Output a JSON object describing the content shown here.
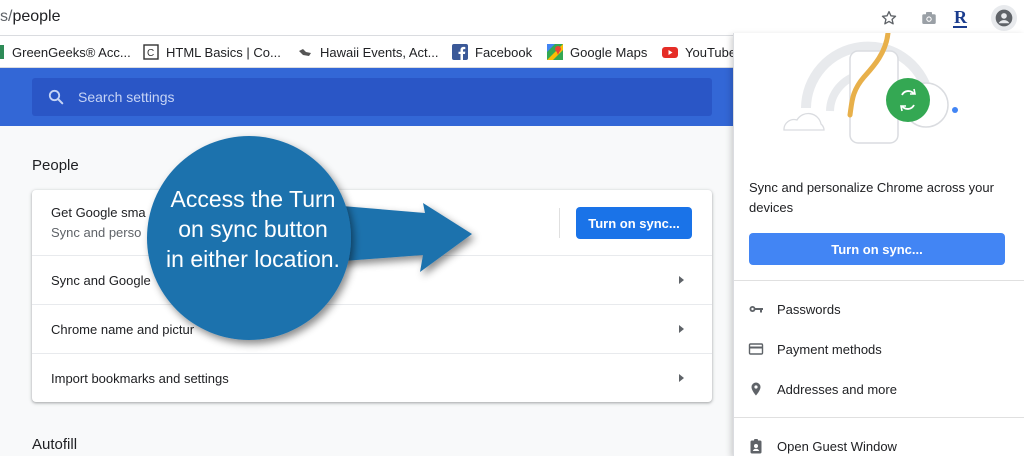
{
  "address_bar": {
    "url_prefix": "s/",
    "url_path": "people"
  },
  "toolbar_icons": [
    "star-icon",
    "camera-icon",
    "extension-r-icon",
    "profile-icon"
  ],
  "bookmarks": [
    {
      "label": "GreenGeeks® Acc...",
      "icon": "greengeeks-favicon"
    },
    {
      "label": "HTML Basics | Co...",
      "icon": "codecademy-favicon"
    },
    {
      "label": "Hawaii Events, Act...",
      "icon": "hawaii-favicon"
    },
    {
      "label": "Facebook",
      "icon": "facebook-favicon"
    },
    {
      "label": "Google Maps",
      "icon": "google-maps-favicon"
    },
    {
      "label": "YouTube",
      "icon": "youtube-favicon"
    }
  ],
  "search": {
    "placeholder": "Search settings"
  },
  "people": {
    "title": "People",
    "row0": {
      "title": "Get Google sma",
      "subtitle": "Sync and perso"
    },
    "turn_on_sync": "Turn on sync...",
    "rows": [
      {
        "label": "Sync and Google"
      },
      {
        "label": "Chrome name and pictur"
      },
      {
        "label": "Import bookmarks and settings"
      }
    ]
  },
  "autofill": {
    "title": "Autofill"
  },
  "callout": {
    "lines": [
      "Access the Turn",
      "on sync button",
      "in either location."
    ]
  },
  "profile_panel": {
    "sync_text": "Sync and personalize Chrome across your devices",
    "turn_on_sync": "Turn on sync...",
    "items": [
      {
        "label": "Passwords",
        "icon": "key-icon"
      },
      {
        "label": "Payment methods",
        "icon": "credit-card-icon"
      },
      {
        "label": "Addresses and more",
        "icon": "location-pin-icon"
      },
      {
        "label": "Open Guest Window",
        "icon": "guest-badge-icon"
      }
    ]
  },
  "colors": {
    "header_blue": "#3367d6",
    "button_blue": "#1a73e8",
    "panel_button_blue": "#4285f4",
    "callout_blue": "#1f72ad"
  }
}
